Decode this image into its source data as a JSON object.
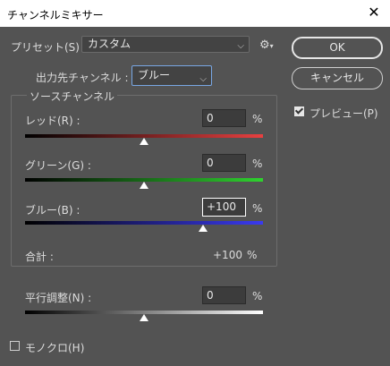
{
  "window": {
    "title": "チャンネルミキサー"
  },
  "preset": {
    "label": "プリセット(S) :",
    "value": "カスタム"
  },
  "output": {
    "label": "出力先チャンネル :",
    "value": "ブルー"
  },
  "source_group": {
    "title": "ソースチャンネル"
  },
  "channels": [
    {
      "label": "レッド(R) :",
      "value": "0",
      "unit": "%",
      "level": 0
    },
    {
      "label": "グリーン(G) :",
      "value": "0",
      "unit": "%",
      "level": 0
    },
    {
      "label": "ブルー(B) :",
      "value": "+100",
      "unit": "%",
      "level": 100
    }
  ],
  "total": {
    "label": "合計 :",
    "value": "+100",
    "unit": "%"
  },
  "constant": {
    "label": "平行調整(N) :",
    "value": "0",
    "unit": "%",
    "level": 0
  },
  "monochrome": {
    "label": "モノクロ(H)",
    "checked": false
  },
  "buttons": {
    "ok": "OK",
    "cancel": "キャンセル"
  },
  "preview": {
    "label": "プレビュー(P)",
    "checked": true
  },
  "colors": {
    "red": "#e84040",
    "green": "#2fd22f",
    "blue": "#3a3af0"
  }
}
